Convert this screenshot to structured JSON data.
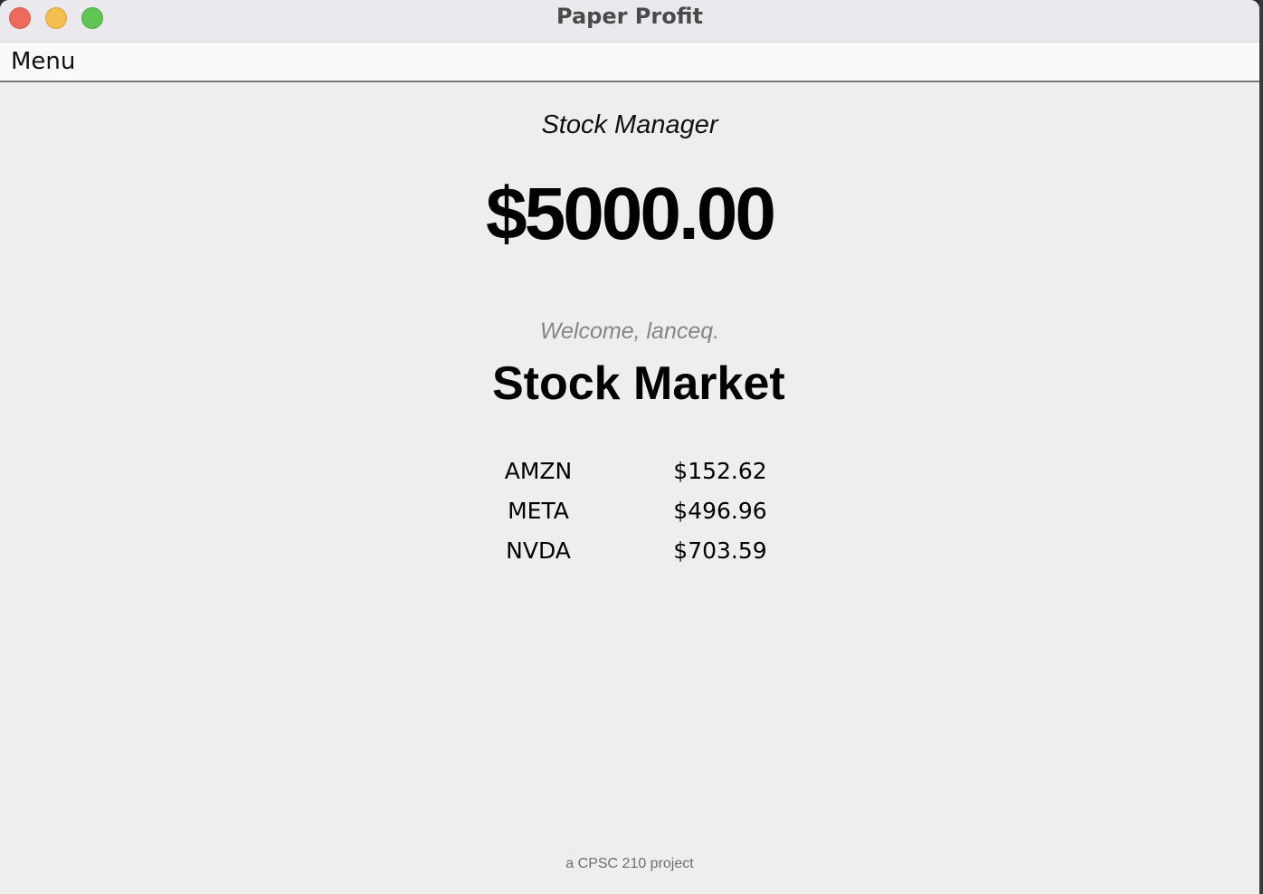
{
  "window": {
    "title": "Paper Profit"
  },
  "menubar": {
    "menu_label": "Menu"
  },
  "main": {
    "subtitle": "Stock Manager",
    "balance": "$5000.00",
    "welcome": "Welcome, lanceq.",
    "market_heading": "Stock Market",
    "stocks": [
      {
        "ticker": "AMZN",
        "price": "$152.62"
      },
      {
        "ticker": "META",
        "price": "$496.96"
      },
      {
        "ticker": "NVDA",
        "price": "$703.59"
      }
    ]
  },
  "footer": {
    "text": "a CPSC 210 project"
  },
  "colors": {
    "close": "#ed6a5e",
    "minimize": "#f5bf4f",
    "maximize": "#61c554",
    "background": "#eeeeee",
    "welcome_text": "#858585"
  },
  "icons": [
    "close-icon",
    "minimize-icon",
    "maximize-icon"
  ]
}
